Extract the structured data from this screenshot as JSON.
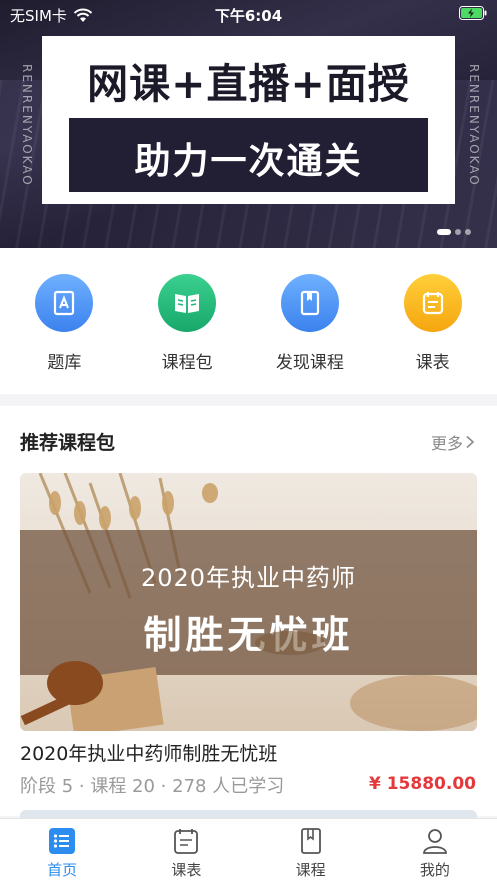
{
  "status_bar": {
    "carrier": "无SIM卡",
    "time": "下午6:04"
  },
  "banner": {
    "side_text": "RENRENYAOKAO",
    "title": "网课+直播+面授",
    "subtitle": "助力一次通关",
    "page_count": 3,
    "active_page": 1
  },
  "quick_nav": [
    {
      "label": "题库",
      "icon": "question-bank-icon",
      "color": "#4a8ff0"
    },
    {
      "label": "课程包",
      "icon": "course-package-icon",
      "color": "#22b87a"
    },
    {
      "label": "发现课程",
      "icon": "discover-course-icon",
      "color": "#4a8ff0"
    },
    {
      "label": "课表",
      "icon": "schedule-icon",
      "color": "#f5b316"
    }
  ],
  "recommend": {
    "title": "推荐课程包",
    "more_label": "更多",
    "course": {
      "image_line1": "2020年执业中药师",
      "image_line2": "制胜无忧班",
      "name": "2020年执业中药师制胜无忧班",
      "meta": "阶段 5 · 课程 20 · 278 人已学习",
      "price": "¥ 15880.00"
    }
  },
  "tab_bar": [
    {
      "label": "首页",
      "icon": "home-list-icon",
      "active": true
    },
    {
      "label": "课表",
      "icon": "schedule-icon",
      "active": false
    },
    {
      "label": "课程",
      "icon": "book-icon",
      "active": false
    },
    {
      "label": "我的",
      "icon": "user-icon",
      "active": false
    }
  ],
  "colors": {
    "accent": "#2d8cf0",
    "price": "#e5383b"
  }
}
